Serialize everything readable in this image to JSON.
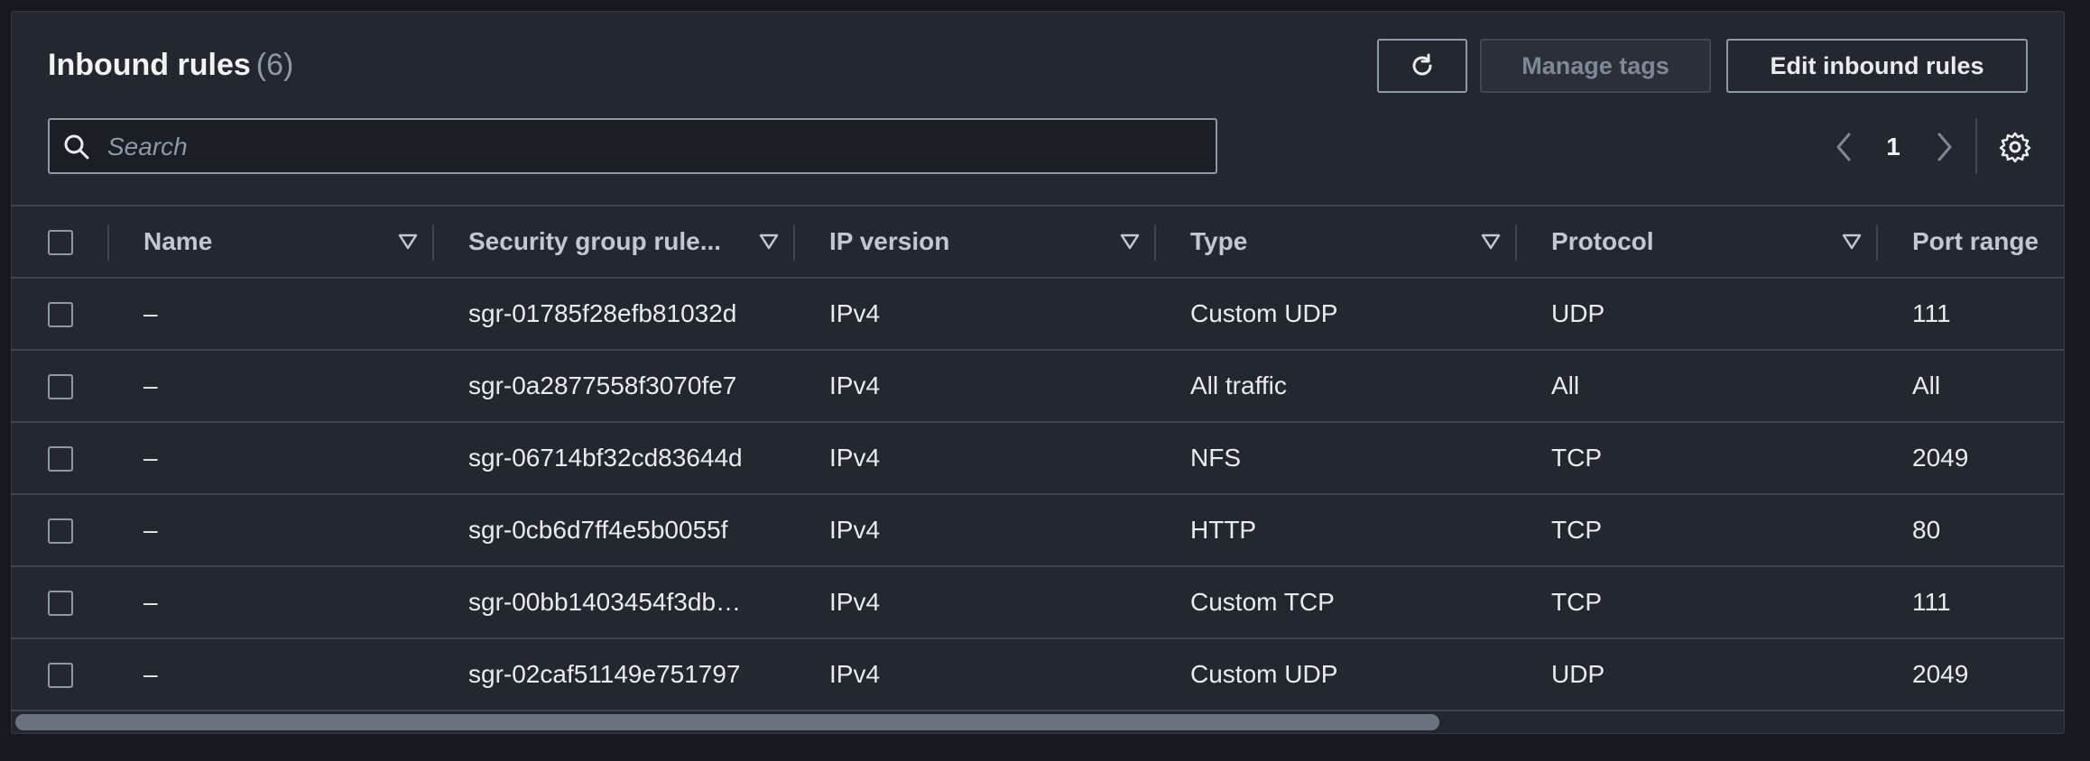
{
  "header": {
    "title": "Inbound rules",
    "count": "(6)"
  },
  "toolbar": {
    "refresh_icon": "refresh-icon",
    "manage_tags_label": "Manage tags",
    "edit_inbound_rules_label": "Edit inbound rules"
  },
  "search": {
    "placeholder": "Search",
    "value": ""
  },
  "pagination": {
    "current_page": "1"
  },
  "table": {
    "columns": [
      "Name",
      "Security group rule...",
      "IP version",
      "Type",
      "Protocol",
      "Port range"
    ],
    "rows": [
      {
        "name": "–",
        "rule_id": "sgr-01785f28efb81032d",
        "ip_version": "IPv4",
        "type": "Custom UDP",
        "protocol": "UDP",
        "port_range": "111"
      },
      {
        "name": "–",
        "rule_id": "sgr-0a2877558f3070fe7",
        "ip_version": "IPv4",
        "type": "All traffic",
        "protocol": "All",
        "port_range": "All"
      },
      {
        "name": "–",
        "rule_id": "sgr-06714bf32cd83644d",
        "ip_version": "IPv4",
        "type": "NFS",
        "protocol": "TCP",
        "port_range": "2049"
      },
      {
        "name": "–",
        "rule_id": "sgr-0cb6d7ff4e5b0055f",
        "ip_version": "IPv4",
        "type": "HTTP",
        "protocol": "TCP",
        "port_range": "80"
      },
      {
        "name": "–",
        "rule_id": "sgr-00bb1403454f3db…",
        "ip_version": "IPv4",
        "type": "Custom TCP",
        "protocol": "TCP",
        "port_range": "111"
      },
      {
        "name": "–",
        "rule_id": "sgr-02caf51149e751797",
        "ip_version": "IPv4",
        "type": "Custom UDP",
        "protocol": "UDP",
        "port_range": "2049"
      }
    ]
  },
  "colors": {
    "background": "#16191f",
    "panel": "#232730",
    "border": "#414750",
    "text": "#e9ebed",
    "muted": "#8d99a8"
  }
}
